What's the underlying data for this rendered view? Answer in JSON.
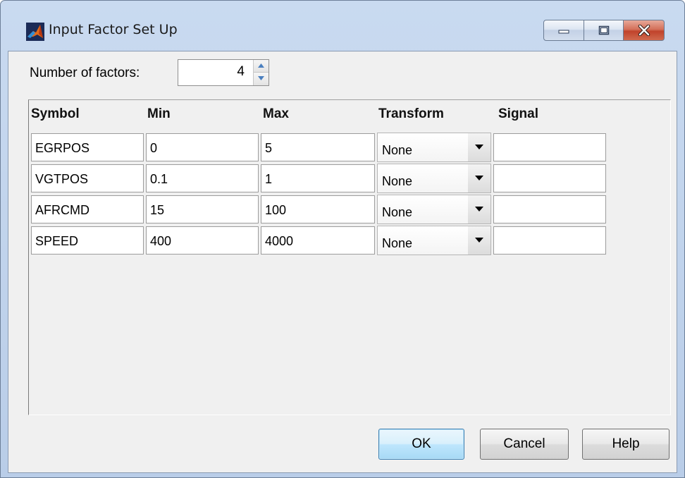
{
  "window": {
    "title": "Input Factor Set Up"
  },
  "controls": {
    "number_of_factors_label": "Number of factors:",
    "number_of_factors_value": "4"
  },
  "table": {
    "headers": [
      "Symbol",
      "Min",
      "Max",
      "Transform",
      "Signal"
    ],
    "rows": [
      {
        "symbol": "EGRPOS",
        "min": "0",
        "max": "5",
        "transform": "None",
        "signal": ""
      },
      {
        "symbol": "VGTPOS",
        "min": "0.1",
        "max": "1",
        "transform": "None",
        "signal": ""
      },
      {
        "symbol": "AFRCMD",
        "min": "15",
        "max": "100",
        "transform": "None",
        "signal": ""
      },
      {
        "symbol": "SPEED",
        "min": "400",
        "max": "4000",
        "transform": "None",
        "signal": ""
      }
    ]
  },
  "buttons": {
    "ok": "OK",
    "cancel": "Cancel",
    "help": "Help"
  },
  "icons": {
    "app": "matlab-membrane-icon",
    "minimize": "minimize-icon",
    "maximize": "maximize-icon",
    "close": "close-icon",
    "spin_up": "caret-up-icon",
    "spin_down": "caret-down-icon",
    "dropdown": "chevron-down-icon"
  },
  "colors": {
    "titlebar": "#c4d7ef",
    "client_bg": "#f0f0f0",
    "close_button": "#c7432b",
    "default_button": "#bee6fd"
  }
}
